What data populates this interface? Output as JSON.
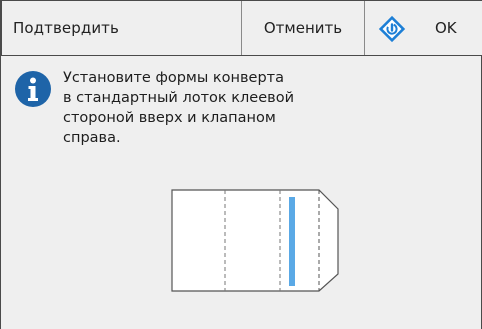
{
  "toolbar": {
    "title": "Подтвердить",
    "cancel_label": "Отменить",
    "ok_label": "OK"
  },
  "message": {
    "lines": [
      "Установите формы конверта",
      "в стандартный лоток клеевой",
      "стороной вверх и клапаном",
      "справа."
    ]
  },
  "icons": {
    "info": "info-icon",
    "ok": "start-diamond-icon",
    "illustration": "envelope-illustration"
  },
  "colors": {
    "accent": "#1d7fd6",
    "envelope_strip": "#5aa9e6",
    "background": "#efefef",
    "info_icon": "#1e64a8"
  }
}
